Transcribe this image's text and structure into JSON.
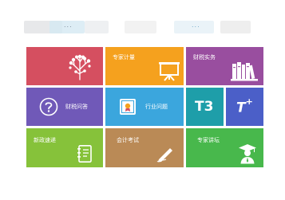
{
  "header": {
    "text_left": "...",
    "text_right": "..."
  },
  "tiles": {
    "expert_plan": {
      "label": "专家计量"
    },
    "tax_practice": {
      "label": "财税实务"
    },
    "tax_qa": {
      "label": "财税问答"
    },
    "industry_issues": {
      "label": "行业问题"
    },
    "t3": {
      "label": "T3"
    },
    "tplus": {
      "label": "T",
      "sup": "+"
    },
    "new_policy": {
      "label": "新政速递"
    },
    "accounting_exam": {
      "label": "会计考试"
    },
    "expert_forum": {
      "label": "专家讲坛"
    }
  },
  "colors": {
    "red": "#d54f60",
    "orange": "#f5a11e",
    "purple": "#994e9f",
    "violet": "#7059b8",
    "blue": "#3ba6dd",
    "teal": "#1e9ea9",
    "indigo": "#4b5fc8",
    "green": "#86c23a",
    "brown": "#ba8a56",
    "lime": "#48b84c"
  },
  "icons": [
    "tree-icon",
    "presentation-board-icon",
    "books-icon",
    "question-circle-icon",
    "certificate-icon",
    "notebook-icon",
    "pen-icon",
    "graduate-icon"
  ]
}
